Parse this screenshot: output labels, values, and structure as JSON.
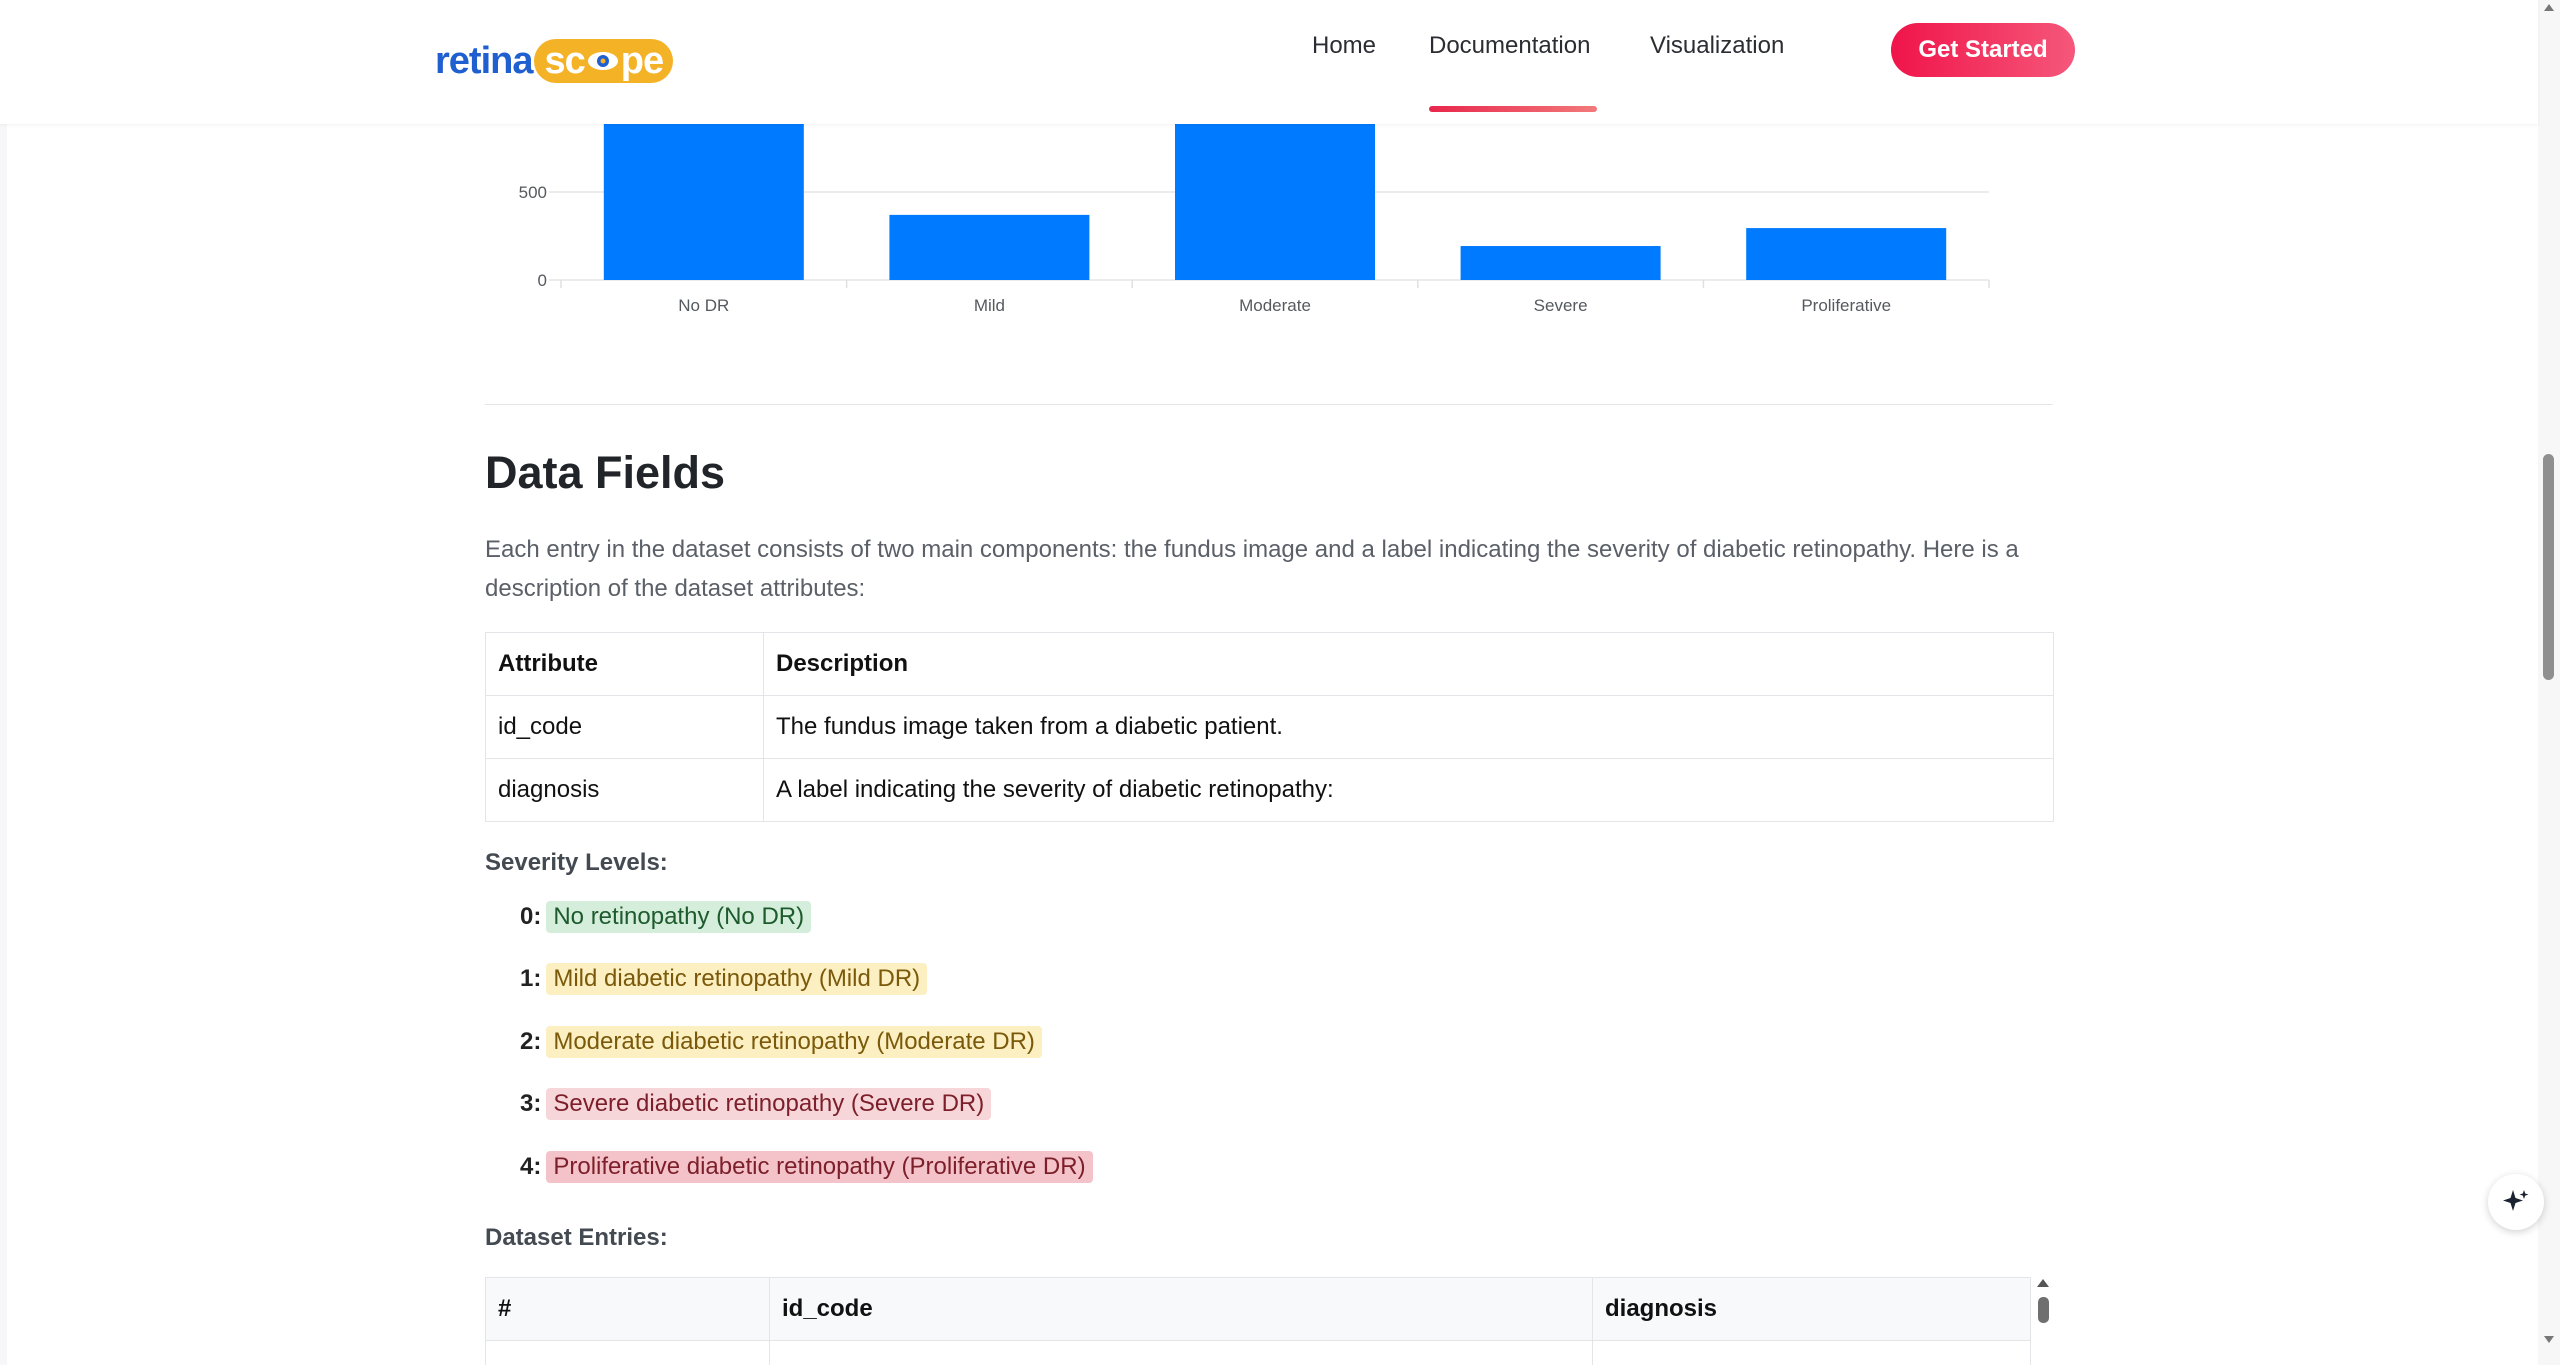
{
  "nav": {
    "logo_part1": "retina",
    "logo_part2": "sc",
    "logo_part3": "pe",
    "links": [
      "Home",
      "Documentation",
      "Visualization"
    ],
    "active": "Documentation",
    "cta": "Get Started"
  },
  "chart_data": {
    "type": "bar",
    "categories": [
      "No DR",
      "Mild",
      "Moderate",
      "Severe",
      "Proliferative"
    ],
    "values": [
      1805,
      370,
      999,
      193,
      295
    ],
    "yticks": [
      0,
      500
    ],
    "color": "#007bff"
  },
  "section": {
    "title": "Data Fields",
    "intro": "Each entry in the dataset consists of two main components: the fundus image and a label indicating the severity of diabetic retinopathy. Here is a description of the dataset attributes:"
  },
  "attributes": {
    "headers": [
      "Attribute",
      "Description"
    ],
    "rows": [
      [
        "id_code",
        "The fundus image taken from a diabetic patient."
      ],
      [
        "diagnosis",
        "A label indicating the severity of diabetic retinopathy:"
      ]
    ]
  },
  "severity": {
    "heading": "Severity Levels:",
    "levels": [
      {
        "num": "0:",
        "label": "No retinopathy (No DR)",
        "color": "#d5eedc"
      },
      {
        "num": "1:",
        "label": "Mild diabetic retinopathy (Mild DR)",
        "color": "#fcefc2"
      },
      {
        "num": "2:",
        "label": "Moderate diabetic retinopathy (Moderate DR)",
        "color": "#fcefc2"
      },
      {
        "num": "3:",
        "label": "Severe diabetic retinopathy (Severe DR)",
        "color": "#f7d6d9"
      },
      {
        "num": "4:",
        "label": "Proliferative diabetic retinopathy (Proliferative DR)",
        "color": "#f4c3c9"
      }
    ]
  },
  "entries": {
    "heading": "Dataset Entries:",
    "headers": [
      "#",
      "id_code",
      "diagnosis"
    ]
  },
  "icons": {
    "ai": "sparkle-icon",
    "scroll_up": "triangle-up-icon",
    "scroll_down": "triangle-down-icon"
  }
}
